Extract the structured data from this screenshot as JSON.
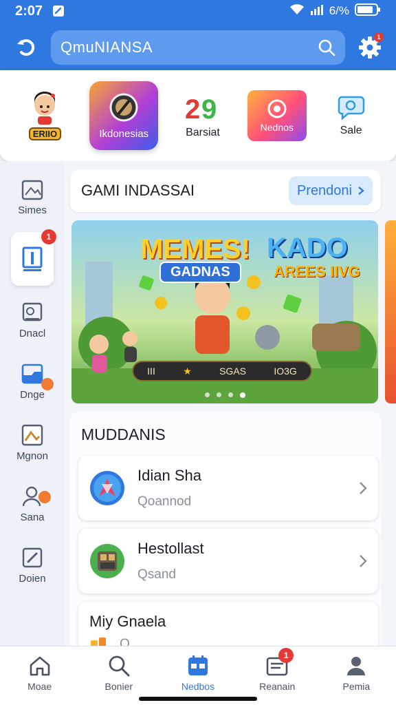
{
  "status": {
    "time": "2:07",
    "battery": "6/%"
  },
  "topbar": {
    "search_text": "QmuNIANSA",
    "settings_badge": "1"
  },
  "categories": [
    {
      "label": "ERIIO"
    },
    {
      "label": "Ikdonesias"
    },
    {
      "label": "Barsiat"
    },
    {
      "label": "Nednos"
    },
    {
      "label": "Sale"
    }
  ],
  "sidebar": [
    {
      "label": "Simes"
    },
    {
      "label": "",
      "badge": "1"
    },
    {
      "label": "Dnacl"
    },
    {
      "label": "Dnge",
      "badge": ""
    },
    {
      "label": "Mgnon"
    },
    {
      "label": "Sana",
      "badge": ""
    },
    {
      "label": "Doien"
    }
  ],
  "games": {
    "title": "GAMI INDASSAI",
    "more_label": "Prendoni"
  },
  "banner": {
    "title_left": "MEMES!",
    "subtitle_left": "GADNAS",
    "title_right": "KADO",
    "subtitle_right": "AREES IIVG",
    "hud_left": "III",
    "hud_mid": "SGAS",
    "hud_right": "IO3G"
  },
  "section": {
    "title": "MUDDANIS",
    "items": [
      {
        "title": "Idian Sha",
        "subtitle": "Qoannod"
      },
      {
        "title": "Hestollast",
        "subtitle": "Qsand"
      },
      {
        "title": "Miy Gnaela",
        "subtitle": "Q"
      }
    ]
  },
  "bottomnav": [
    {
      "label": "Moae"
    },
    {
      "label": "Bonier"
    },
    {
      "label": "Nedbos"
    },
    {
      "label": "Reanain",
      "badge": "1"
    },
    {
      "label": "Pemia"
    }
  ],
  "colors": {
    "primary": "#2f78e0",
    "badge": "#e53935",
    "background": "#eef2f8"
  }
}
